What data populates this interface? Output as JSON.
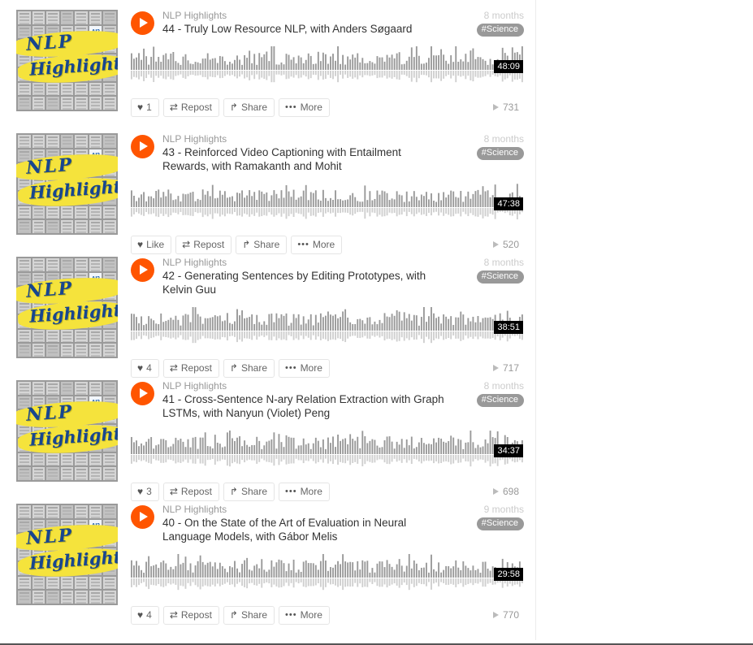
{
  "colors": {
    "accent": "#ff5500",
    "tag_bg": "#999999",
    "duration_bg": "#000000",
    "text": "#333333",
    "muted": "#999999"
  },
  "artwork": {
    "line1": "NLP",
    "line2": "Highlights",
    "logo_label": "AI2"
  },
  "actions": {
    "repost_label": "Repost",
    "share_label": "Share",
    "more_label": "More",
    "like_label": "Like",
    "heart_glyph": "♥",
    "repost_glyph": "⇄",
    "share_glyph": "↱",
    "more_glyph": "•••"
  },
  "tracks": [
    {
      "artist": "NLP Highlights",
      "title": "44 - Truly Low Resource NLP, with Anders Søgaard",
      "age": "8 months",
      "tag": "#Science",
      "duration": "48:09",
      "likes": "1",
      "plays": "731"
    },
    {
      "artist": "NLP Highlights",
      "title": "43 - Reinforced Video Captioning with Entailment Rewards, with Ramakanth and Mohit",
      "age": "8 months",
      "tag": "#Science",
      "duration": "47:38",
      "likes": "Like",
      "plays": "520"
    },
    {
      "artist": "NLP Highlights",
      "title": "42 - Generating Sentences by Editing Prototypes, with Kelvin Guu",
      "age": "8 months",
      "tag": "#Science",
      "duration": "38:51",
      "likes": "4",
      "plays": "717"
    },
    {
      "artist": "NLP Highlights",
      "title": "41 - Cross-Sentence N-ary Relation Extraction with Graph LSTMs, with Nanyun (Violet) Peng",
      "age": "8 months",
      "tag": "#Science",
      "duration": "34:37",
      "likes": "3",
      "plays": "698"
    },
    {
      "artist": "NLP Highlights",
      "title": "40 - On the State of the Art of Evaluation in Neural Language Models, with Gábor Melis",
      "age": "9 months",
      "tag": "#Science",
      "duration": "29:58",
      "likes": "4",
      "plays": "770"
    }
  ]
}
